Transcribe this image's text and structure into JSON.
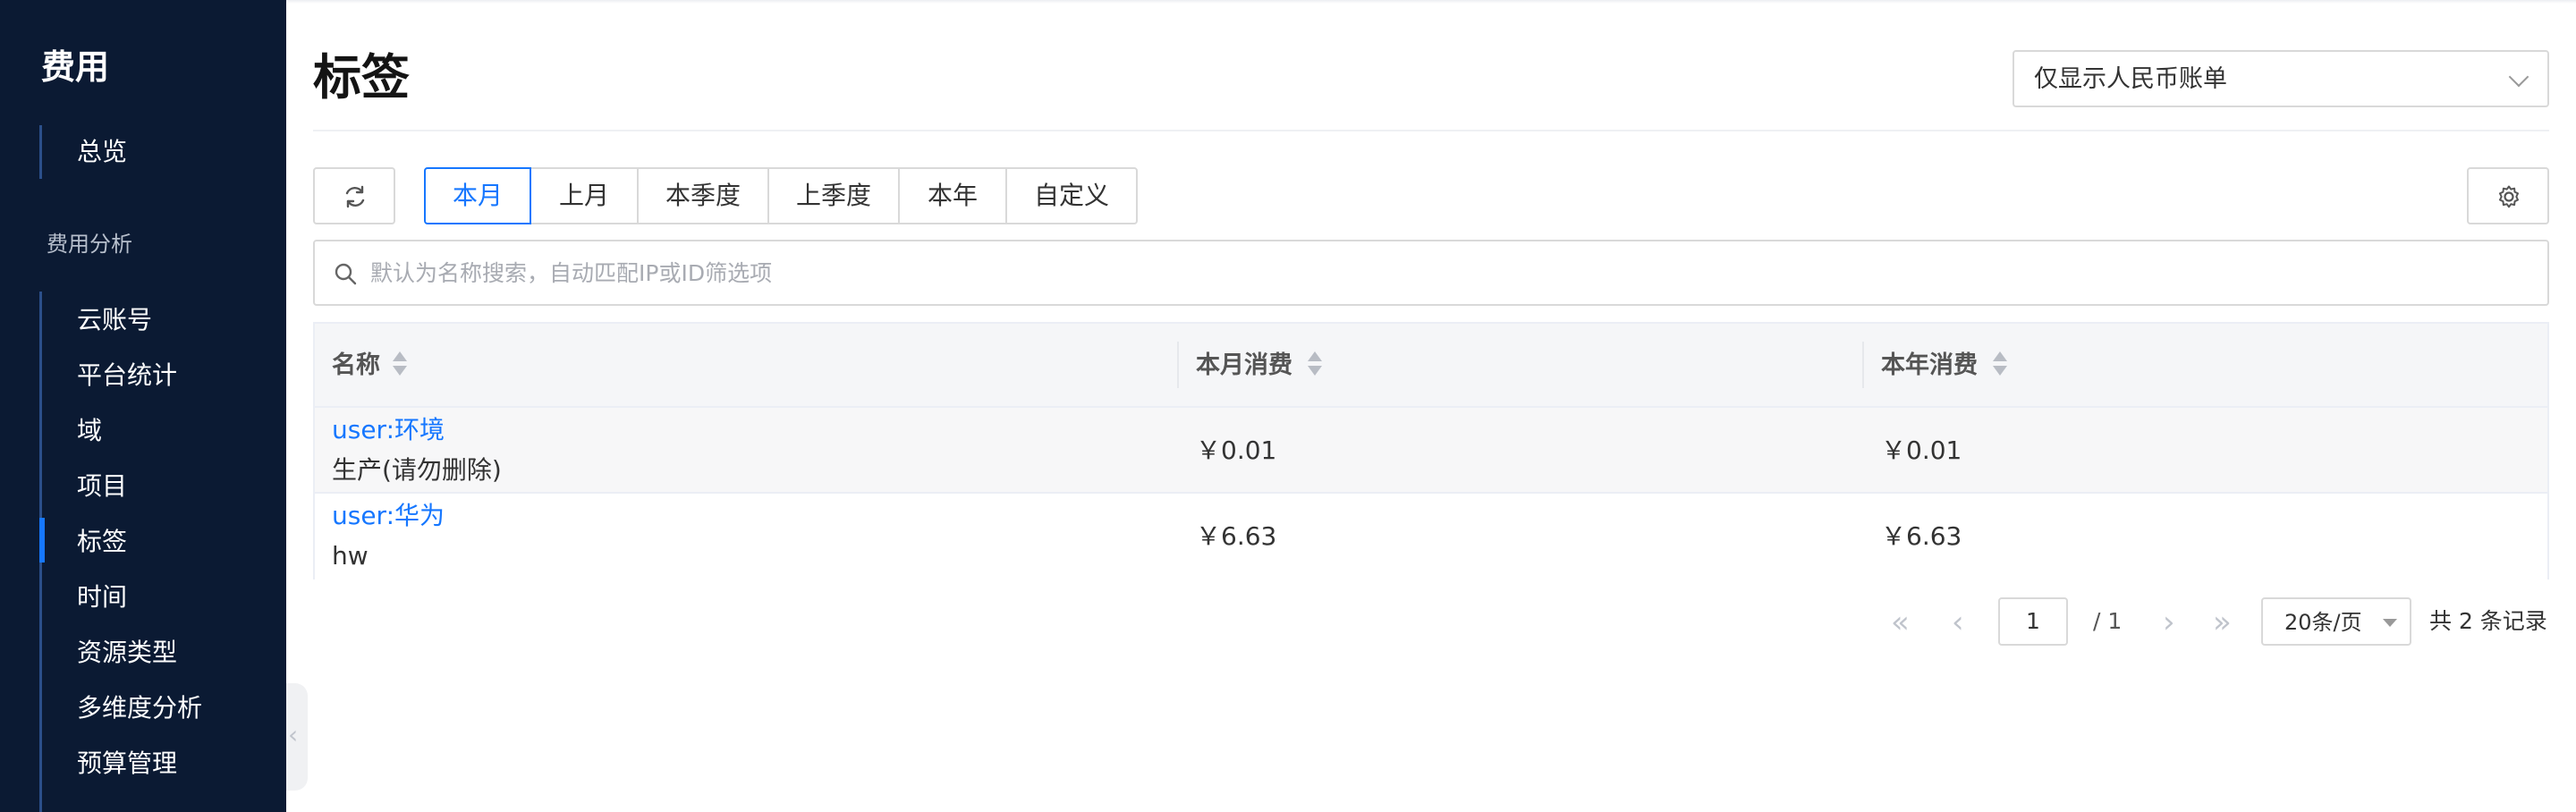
{
  "sidebar": {
    "title": "费用",
    "overview": "总览",
    "group_label": "费用分析",
    "items": [
      {
        "label": "云账号"
      },
      {
        "label": "平台统计"
      },
      {
        "label": "域"
      },
      {
        "label": "项目"
      },
      {
        "label": "标签",
        "active": true
      },
      {
        "label": "时间"
      },
      {
        "label": "资源类型"
      },
      {
        "label": "多维度分析"
      },
      {
        "label": "预算管理"
      }
    ],
    "collapse_icon": "chevron-left-icon"
  },
  "header": {
    "title": "标签",
    "currency_filter": "仅显示人民币账单"
  },
  "toolbar": {
    "refresh_icon": "refresh-icon",
    "settings_icon": "gear-icon",
    "tabs": [
      {
        "label": "本月",
        "active": true
      },
      {
        "label": "上月"
      },
      {
        "label": "本季度"
      },
      {
        "label": "上季度"
      },
      {
        "label": "本年"
      },
      {
        "label": "自定义"
      }
    ]
  },
  "search": {
    "placeholder": "默认为名称搜索，自动匹配IP或ID筛选项"
  },
  "table": {
    "columns": [
      "名称",
      "本月消费",
      "本年消费"
    ],
    "rows": [
      {
        "name_key": "user:环境",
        "name_value": "生产(请勿删除)",
        "month_cost": "￥0.01",
        "year_cost": "￥0.01"
      },
      {
        "name_key": "user:华为",
        "name_value": "hw",
        "month_cost": "￥6.63",
        "year_cost": "￥6.63"
      }
    ]
  },
  "pagination": {
    "current_page": "1",
    "total_pages": "/ 1",
    "page_size": "20条/页",
    "total": "共 2 条记录"
  },
  "colors": {
    "sidebar_bg": "#0b1a33",
    "accent": "#1677ff"
  }
}
